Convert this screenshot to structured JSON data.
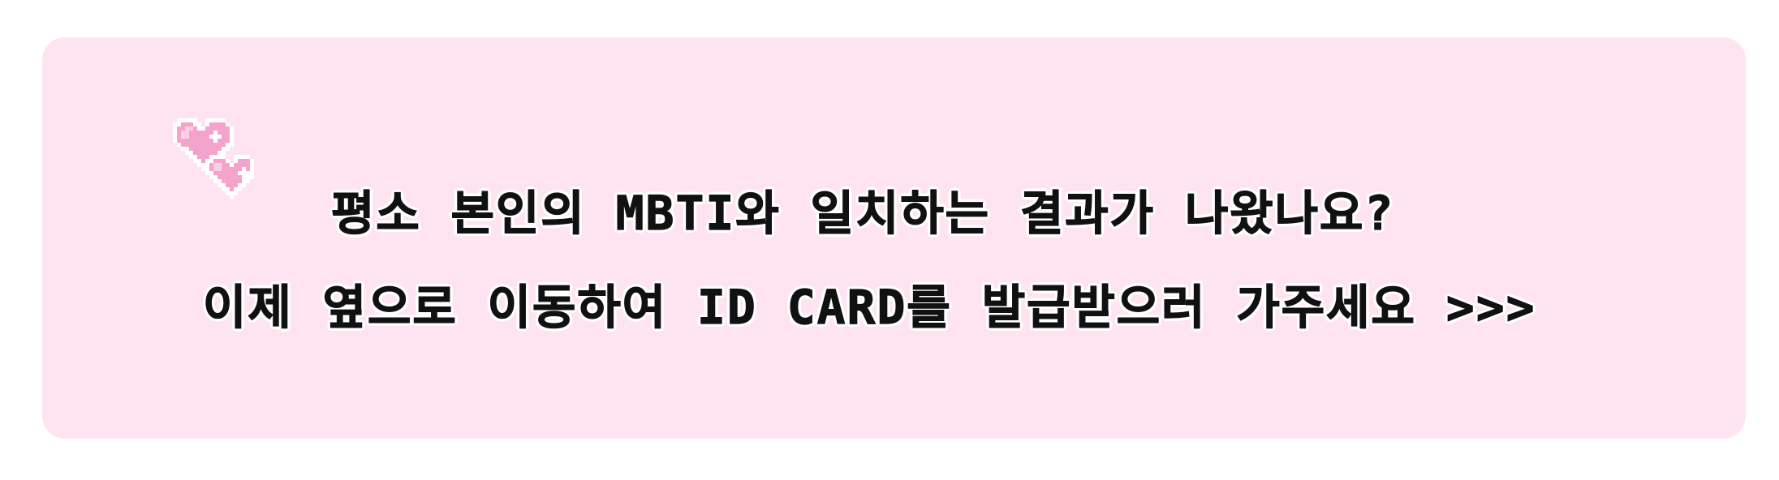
{
  "notice": {
    "line1": "평소 본인의 MBTI와 일치하는 결과가 나왔나요?",
    "line2": "이제 옆으로 이동하여 ID CARD를 발급받으러 가주세요 >>>"
  },
  "icons": {
    "decoration": "pixel-hearts-icon"
  },
  "colors": {
    "card_background": "#fee4f1",
    "heart_fill": "#f7a8cf",
    "text": "#111111"
  }
}
